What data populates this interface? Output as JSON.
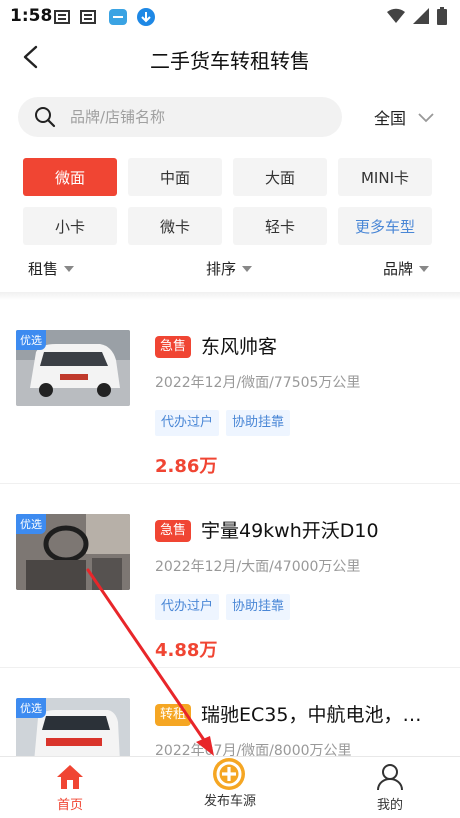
{
  "status_bar": {
    "time": "1:58"
  },
  "header": {
    "title": "二手货车转租转售"
  },
  "search": {
    "placeholder": "品牌/店铺名称",
    "region": "全国"
  },
  "categories": [
    {
      "label": "微面",
      "active": true
    },
    {
      "label": "中面"
    },
    {
      "label": "大面"
    },
    {
      "label": "MINI卡"
    },
    {
      "label": "小卡"
    },
    {
      "label": "微卡"
    },
    {
      "label": "轻卡"
    },
    {
      "label": "更多车型",
      "more": true
    }
  ],
  "filters": [
    {
      "label": "租售"
    },
    {
      "label": "排序"
    },
    {
      "label": "品牌"
    }
  ],
  "listings": [
    {
      "badge": "优选",
      "status": "急售",
      "title": "东风帅客",
      "meta": "2022年12月/微面/77505万公里",
      "tags": [
        "代办过户",
        "协助挂靠"
      ],
      "price": "2.86万"
    },
    {
      "badge": "优选",
      "status": "急售",
      "title": "宇量49kwh开沃D10",
      "meta": "2022年12月/大面/47000万公里",
      "tags": [
        "代办过户",
        "协助挂靠"
      ],
      "price": "4.88万"
    },
    {
      "badge": "优选",
      "status": "转租",
      "title": "瑞驰EC35，中航电池，…",
      "meta": "2022年07月/微面/8000万公里",
      "tags": [],
      "price": ""
    }
  ],
  "bottom_nav": {
    "home": "首页",
    "publish": "发布车源",
    "mine": "我的"
  },
  "colors": {
    "accent": "#f04533",
    "link": "#4a87d6",
    "badge": "#3d8bf0",
    "annotation_arrow": "#e8262a"
  }
}
